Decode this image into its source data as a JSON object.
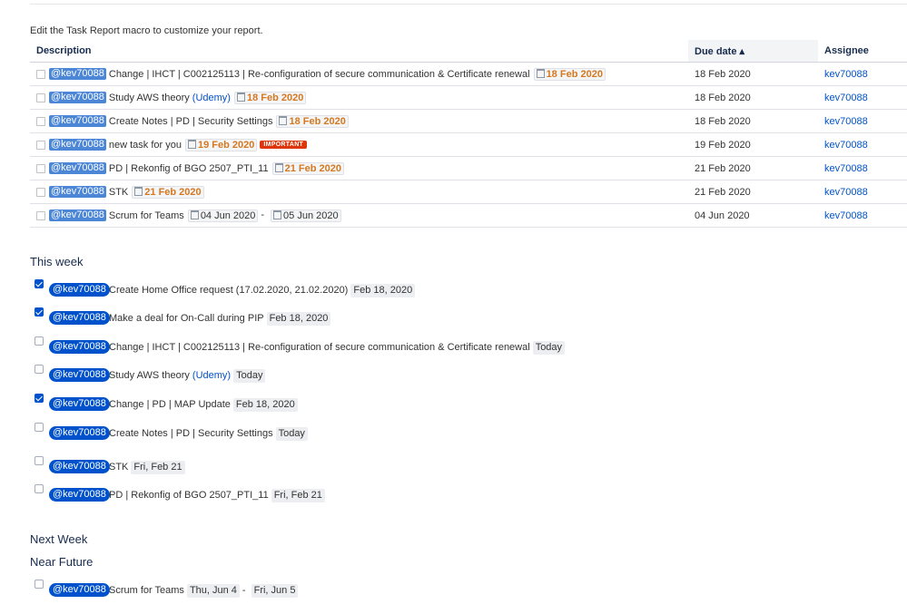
{
  "intro": "Edit the Task Report macro to customize your report.",
  "table": {
    "headers": {
      "description": "Description",
      "due": "Due date ▴",
      "assignee": "Assignee"
    },
    "rows": [
      {
        "mention": "@kev70088",
        "text": "Change | IHCT | C002125113 | Re-configuration of secure communication & Certificate renewal",
        "date": "18 Feb 2020",
        "due": "18 Feb 2020",
        "assignee": "kev70088"
      },
      {
        "mention": "@kev70088",
        "text": "Study AWS theory",
        "link": "(Udemy)",
        "date": "18 Feb 2020",
        "due": "18 Feb 2020",
        "assignee": "kev70088"
      },
      {
        "mention": "@kev70088",
        "text": "Create Notes | PD | Security Settings",
        "date": "18 Feb 2020",
        "due": "18 Feb 2020",
        "assignee": "kev70088"
      },
      {
        "mention": "@kev70088",
        "text": "new task for you",
        "date": "19 Feb 2020",
        "badge": "IMPORTANT",
        "due": "19 Feb 2020",
        "assignee": "kev70088"
      },
      {
        "mention": "@kev70088",
        "text": "PD | Rekonfig of BGO 2507_PTI_11",
        "date": "21 Feb 2020",
        "due": "21 Feb 2020",
        "assignee": "kev70088"
      },
      {
        "mention": "@kev70088",
        "text": "STK",
        "date": "21 Feb 2020",
        "due": "21 Feb 2020",
        "assignee": "kev70088"
      },
      {
        "mention": "@kev70088",
        "text": "Scrum for Teams",
        "date_start": "04 Jun 2020",
        "sep": "-",
        "date_end": "05 Jun 2020",
        "due": "04 Jun 2020",
        "assignee": "kev70088"
      }
    ]
  },
  "sections": {
    "this_week": "This week",
    "next_week": "Next Week",
    "near_future": "Near Future"
  },
  "this_week_tasks": [
    {
      "checked": true,
      "mention": "@kev70088",
      "text": "Create Home Office request (17.02.2020, 21.02.2020)",
      "date": "Feb 18, 2020"
    },
    {
      "checked": true,
      "mention": "@kev70088",
      "text": "Make a deal for On-Call during PIP",
      "date": "Feb 18, 2020"
    },
    {
      "checked": false,
      "mention": "@kev70088",
      "text": "Change | IHCT | C002125113 | Re-configuration of secure communication & Certificate renewal",
      "date": "Today"
    },
    {
      "checked": false,
      "mention": "@kev70088",
      "text": "Study AWS theory",
      "link": "(Udemy)",
      "date": "Today"
    },
    {
      "checked": true,
      "mention": "@kev70088",
      "text": "Change | PD | MAP Update",
      "date": "Feb 18, 2020"
    },
    {
      "checked": false,
      "mention": "@kev70088",
      "text": "Create Notes | PD | Security Settings",
      "date": "Today"
    },
    {
      "checked": false,
      "mention": "@kev70088",
      "text": "STK",
      "date": "Fri, Feb 21"
    },
    {
      "checked": false,
      "mention": "@kev70088",
      "text": "PD | Rekonfig of BGO 2507_PTI_11",
      "date": "Fri, Feb 21"
    }
  ],
  "near_future_tasks": [
    {
      "checked": false,
      "mention": "@kev70088",
      "text": "Scrum for Teams",
      "date_start": "Thu, Jun 4",
      "sep": "-",
      "date_end": "Fri, Jun 5"
    }
  ],
  "colors": {
    "mention_bg": "#0052cc",
    "overdue": "#d5781f",
    "important": "#de350b",
    "link": "#0052cc"
  },
  "icons": {
    "checkbox": "checkbox-icon",
    "calendar": "calendar-icon"
  }
}
